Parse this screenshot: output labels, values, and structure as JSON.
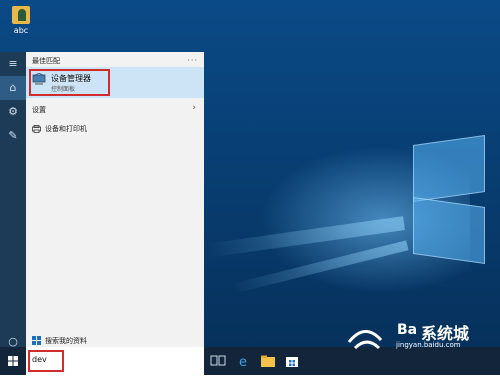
{
  "desktop": {
    "icon_label": "abc",
    "watermark_brand": "系统城",
    "watermark_fragment": "Ba",
    "watermark_url": "jingyan.baidu.com"
  },
  "start_menu": {
    "best_match_header": "最佳匹配",
    "more_label": "···",
    "best_match": {
      "title": "设备管理器",
      "subtitle": "控制面板",
      "icon": "device-manager-icon"
    },
    "settings_header": "设置",
    "settings_items": [
      {
        "label": "设备和打印机",
        "icon": "printer-icon"
      }
    ],
    "search_web_label": "搜索我的资料"
  },
  "rail": {
    "icons": [
      "hamburger-icon",
      "home-icon",
      "gear-icon",
      "feedback-icon",
      "cortana-circle-icon"
    ]
  },
  "taskbar": {
    "search_value": "dev",
    "icons": [
      "task-view-icon",
      "edge-icon",
      "file-explorer-icon",
      "store-icon"
    ]
  },
  "colors": {
    "accent": "#cde4f7",
    "highlight_border": "#d12b2b",
    "taskbar": "#13253a"
  }
}
